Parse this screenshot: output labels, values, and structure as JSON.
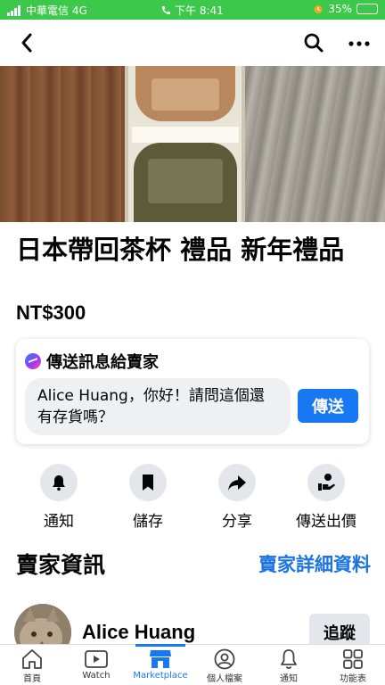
{
  "status_bar": {
    "carrier": "中華電信",
    "network": "4G",
    "time": "下午 8:41",
    "battery": "35%",
    "battery_level": 0.35
  },
  "top_bar": {
    "back_icon": "back-chevron-icon",
    "search_icon": "search-icon",
    "more_icon": "more-dots-icon"
  },
  "product": {
    "title": "日本帶回茶杯 禮品 新年禮品",
    "price": "NT$300"
  },
  "message": {
    "header": "傳送訊息給賣家",
    "input_text": "Alice Huang，你好！請問這個還有存貨嗎？",
    "send_label": "傳送"
  },
  "actions": [
    {
      "label": "通知",
      "icon": "bell-icon"
    },
    {
      "label": "儲存",
      "icon": "bookmark-icon"
    },
    {
      "label": "分享",
      "icon": "share-arrow-icon"
    },
    {
      "label": "傳送出價",
      "icon": "offer-hand-icon"
    }
  ],
  "seller": {
    "heading": "賣家資訊",
    "details_link": "賣家詳細資料",
    "name": "Alice Huang",
    "follow_label": "追蹤"
  },
  "bottom_nav": [
    {
      "label": "首頁",
      "icon": "home-icon"
    },
    {
      "label": "Watch",
      "icon": "watch-play-icon"
    },
    {
      "label": "Marketplace",
      "icon": "marketplace-shop-icon",
      "active": true
    },
    {
      "label": "個人檔案",
      "icon": "profile-icon"
    },
    {
      "label": "通知",
      "icon": "bell-icon"
    },
    {
      "label": "功能表",
      "icon": "menu-grid-icon"
    }
  ],
  "colors": {
    "status_bar": "#3cc84a",
    "accent": "#1877f2",
    "button_gray": "#e4e6eb"
  }
}
